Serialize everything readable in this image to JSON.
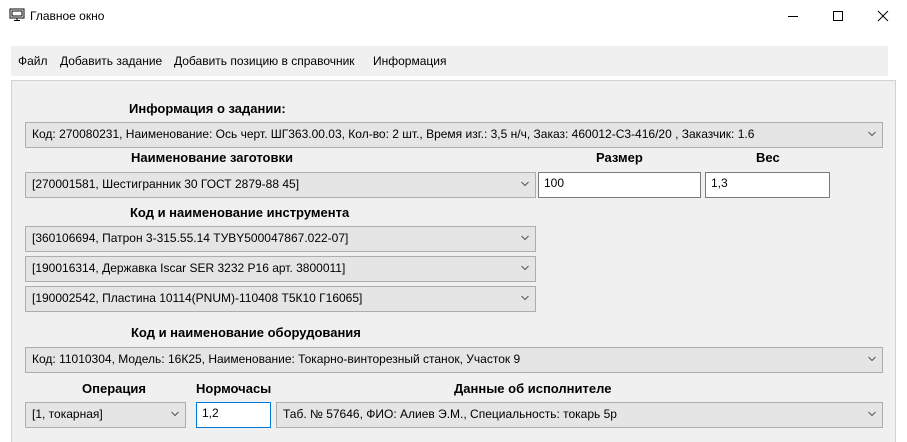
{
  "window": {
    "title": "Главное окно",
    "icon": "computer-icon",
    "controls": [
      "minimize-icon",
      "maximize-icon",
      "close-icon"
    ]
  },
  "menu": {
    "items": [
      {
        "label": "Файл"
      },
      {
        "label": "Добавить задание"
      },
      {
        "label": "Добавить позицию в справочник"
      },
      {
        "label": "Информация"
      }
    ]
  },
  "task": {
    "label": "Информация о задании:",
    "value": "Код: 270080231, Наименование: Ось черт. ШГ363.00.03, Кол-во: 2 шт., Время изг.: 3,5 н/ч, Заказ: 460012-С3-416/20   , Заказчик: 1.6"
  },
  "blank": {
    "label": "Наименование заготовки",
    "value": "[270001581, Шестигранник 30 ГОСТ 2879-88 45]",
    "size_label": "Размер",
    "size_value": "100",
    "weight_label": "Вес",
    "weight_value": "1,3"
  },
  "tools": {
    "label": "Код и наименование инструмента",
    "items": [
      "[360106694, Патрон 3-315.55.14 ТУBY500047867.022-07]",
      "[190016314, Державка Iscar SER 3232 P16 арт. 3800011]",
      "[190002542, Пластина 10114(PNUM)-110408 Т5К10 Г16065]"
    ]
  },
  "equipment": {
    "label": "Код и наименование оборудования",
    "value": "Код: 11010304, Модель: 16К25, Наименование: Токарно-винторезный станок, Участок 9"
  },
  "operation": {
    "label": "Операция",
    "value": "[1, токарная]",
    "hours_label": "Нормочасы",
    "hours_value": "1,2",
    "executor_label": "Данные об исполнителе",
    "executor_value": "Таб. № 57646, ФИО: Алиев Э.М., Специальность: токарь 5р"
  },
  "colors": {
    "panel_bg": "#f0f0f0",
    "combo_bg": "#e5e5e5",
    "focus_border": "#0078d7"
  }
}
